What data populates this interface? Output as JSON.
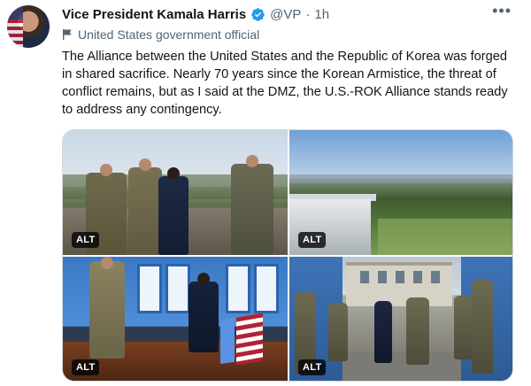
{
  "author": {
    "name": "Vice President Kamala Harris",
    "handle": "@VP",
    "separator": "·",
    "time": "1h",
    "label": "United States government official",
    "verified_color": "#1d9bf0"
  },
  "more_icon": "more-horizontal-icon",
  "tweet": {
    "text": "The Alliance between the United States and the Republic of Korea was forged in shared sacrifice. Nearly 70 years since the Korean Armistice, the threat of conflict remains, but as I said at the DMZ, the U.S.-ROK Alliance stands ready to address any contingency."
  },
  "media": [
    {
      "alt_badge": "ALT"
    },
    {
      "alt_badge": "ALT"
    },
    {
      "alt_badge": "ALT"
    },
    {
      "alt_badge": "ALT"
    }
  ]
}
